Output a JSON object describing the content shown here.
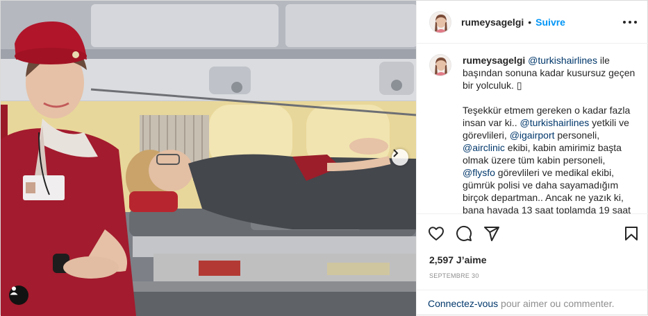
{
  "post": {
    "username": "rumeysagelgi",
    "separator": "•",
    "follow_label": "Suivre",
    "more_icon": "more-horizontal-icon"
  },
  "caption": {
    "username": "rumeysagelgi",
    "mention_1": "@turkishairlines",
    "line_1_rest": " ile başından sonuna kadar kusursuz geçen bir yolculuk. ",
    "emoji_box": "▯",
    "line_2a": "Teşekkür etmem gereken o kadar fazla insan var ki.. ",
    "mention_2": "@turkishairlines",
    "line_2b": " yetkili ve görevlileri, ",
    "mention_3": "@igairport",
    "line_2c": " personeli, ",
    "mention_4": "@airclinic",
    "line_2d": " ekibi, kabin amirimiz başta olmak üzere tüm kabin personeli, ",
    "mention_5": "@flysfo",
    "line_2e": " görevlileri ve medikal ekibi, gümrük polisi ve daha sayamadığım birçok departman.. Ancak ne yazık ki, bana havada 13 saat toplamda 19 saat"
  },
  "actions": {
    "like_icon": "heart-icon",
    "comment_icon": "comment-icon",
    "share_icon": "paper-plane-icon",
    "save_icon": "bookmark-icon",
    "likes_count": "2,597",
    "likes_label": " J’aime",
    "date": "Septembre 30"
  },
  "login": {
    "link_label": "Connectez-vous",
    "rest": " pour aimer ou commenter."
  },
  "media": {
    "next_icon": "chevron-right-icon",
    "user_tag_icon": "user-tag-icon"
  },
  "colors": {
    "link_blue": "#0095f6",
    "mention": "#00376b",
    "muted": "#8e8e8e",
    "uniform_red": "#a31b2e"
  }
}
